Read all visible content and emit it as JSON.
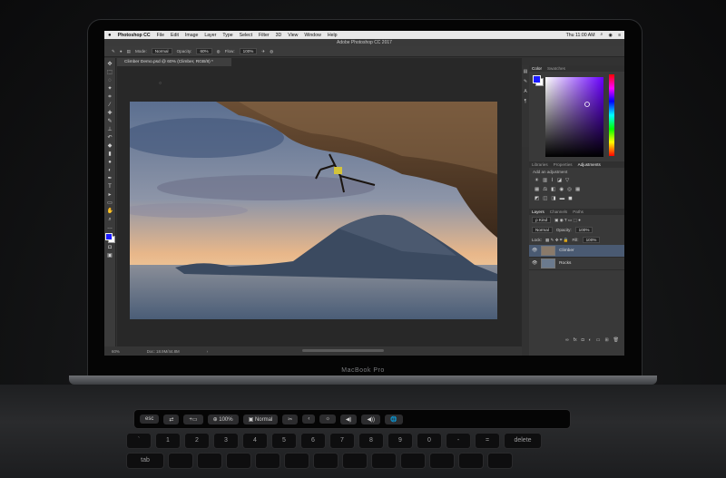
{
  "menubar": {
    "apple_icon": "apple-icon",
    "items": [
      "Photoshop CC",
      "File",
      "Edit",
      "Image",
      "Layer",
      "Type",
      "Select",
      "Filter",
      "3D",
      "View",
      "Window",
      "Help"
    ],
    "clock": "Thu 11:00 AM"
  },
  "window": {
    "title": "Adobe Photoshop CC 2017"
  },
  "options": {
    "mode_label": "Mode:",
    "mode_value": "Normal",
    "opacity_label": "Opacity:",
    "opacity_value": "60%",
    "flow_label": "Flow:",
    "flow_value": "100%"
  },
  "document": {
    "tab_title": "Climber Demo.psd @ 60% (Climber, RGB/8) *",
    "zoom": "60%",
    "doc_size": "Doc: 18.9M/44.8M"
  },
  "panels": {
    "color_tabs": [
      "Color",
      "Swatches"
    ],
    "adjust_tabs": [
      "Libraries",
      "Properties",
      "Adjustments"
    ],
    "add_adjustment": "Add an adjustment",
    "layer_tabs": [
      "Layers",
      "Channels",
      "Paths"
    ],
    "kind_filter": "ρ Kind",
    "blend_mode": "Normal",
    "opacity_label": "Opacity:",
    "opacity_value": "100%",
    "lock_label": "Lock:",
    "fill_label": "Fill:",
    "fill_value": "100%",
    "layers": [
      {
        "name": "Climber",
        "selected": true
      },
      {
        "name": "Rocks",
        "selected": false
      }
    ]
  },
  "laptop": {
    "model_label": "MacBook Pro"
  },
  "touchbar": {
    "items": [
      "esc",
      "⇄",
      "+▭",
      "⊕ 100%",
      "▣ Normal",
      "✂",
      "‹",
      "☼",
      "◀)",
      "◀))",
      "🌐"
    ],
    "zoom_value": "100%",
    "blend_value": "Normal"
  },
  "keyboard": {
    "row1": [
      "`",
      "1",
      "2",
      "3",
      "4",
      "5",
      "6",
      "7",
      "8",
      "9",
      "0",
      "-",
      "=",
      "delete"
    ],
    "tab_key": "tab"
  },
  "colors": {
    "foreground": "#1b1bff",
    "background": "#ffffff",
    "selected_layer": "#4a5a72"
  }
}
